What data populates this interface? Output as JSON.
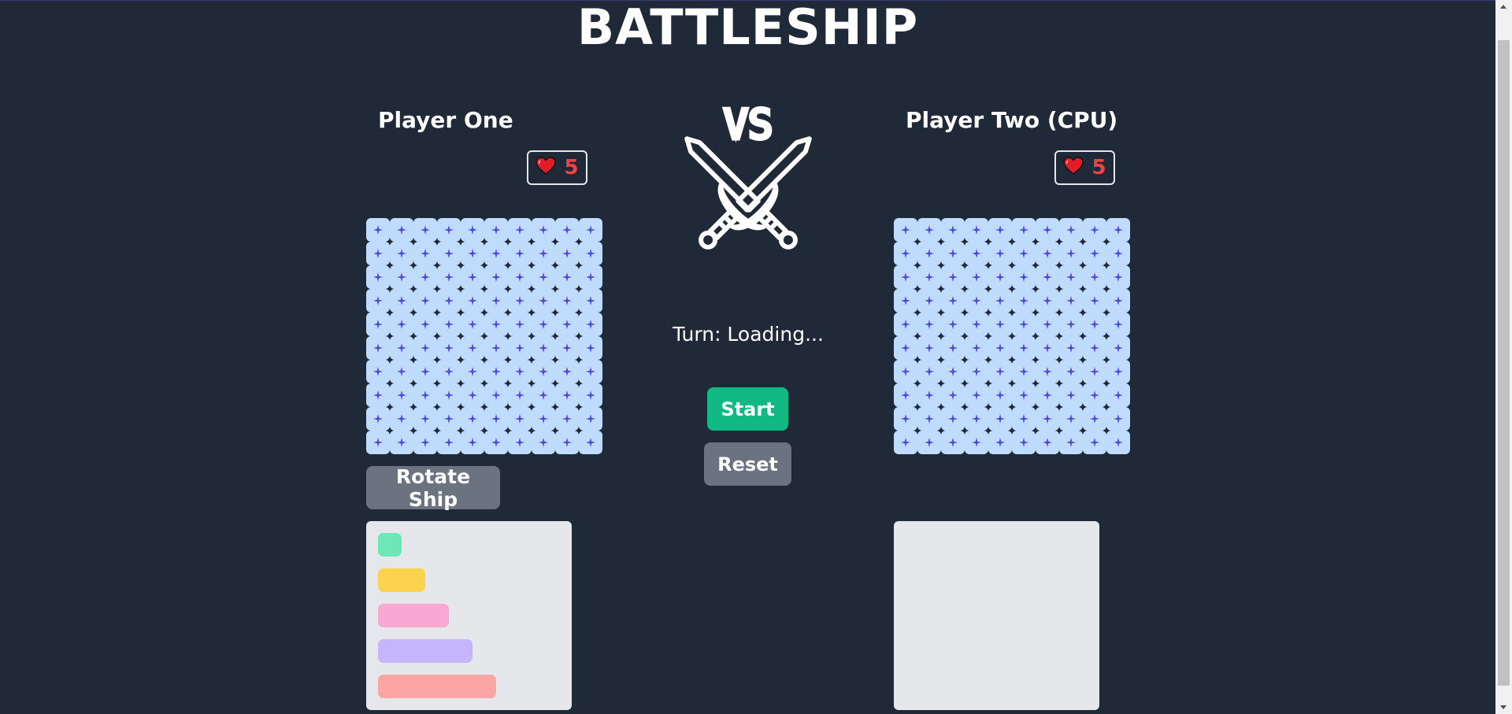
{
  "app": {
    "title": "BATTLESHIP"
  },
  "players": [
    {
      "name": "Player One",
      "lives": "5"
    },
    {
      "name": "Player Two (CPU)",
      "lives": "5"
    }
  ],
  "center": {
    "vs_label": "VS",
    "turn_text": "Turn: Loading...",
    "start_label": "Start",
    "reset_label": "Reset"
  },
  "controls": {
    "rotate_label": "Rotate Ship"
  },
  "board": {
    "rows": 10,
    "cols": 10
  },
  "ships": [
    {
      "name": "ship-size-1",
      "length": 1,
      "color": "#6ee7b7"
    },
    {
      "name": "ship-size-2",
      "length": 2,
      "color": "#fcd34d"
    },
    {
      "name": "ship-size-3",
      "length": 3,
      "color": "#f9a8d4"
    },
    {
      "name": "ship-size-4",
      "length": 4,
      "color": "#c4b5fd"
    },
    {
      "name": "ship-size-5",
      "length": 5,
      "color": "#fca5a5"
    }
  ],
  "colors": {
    "background": "#1f2937",
    "cell": "#bfdbfe",
    "cell_mark": "#4f46e5",
    "start": "#10b981",
    "secondary": "#6b7280",
    "heart": "#ef4444",
    "dock": "#e5e7eb"
  },
  "icons": {
    "lives": "heart-icon",
    "versus": "crossed-swords-icon",
    "cell_mark": "sparkle-icon"
  }
}
